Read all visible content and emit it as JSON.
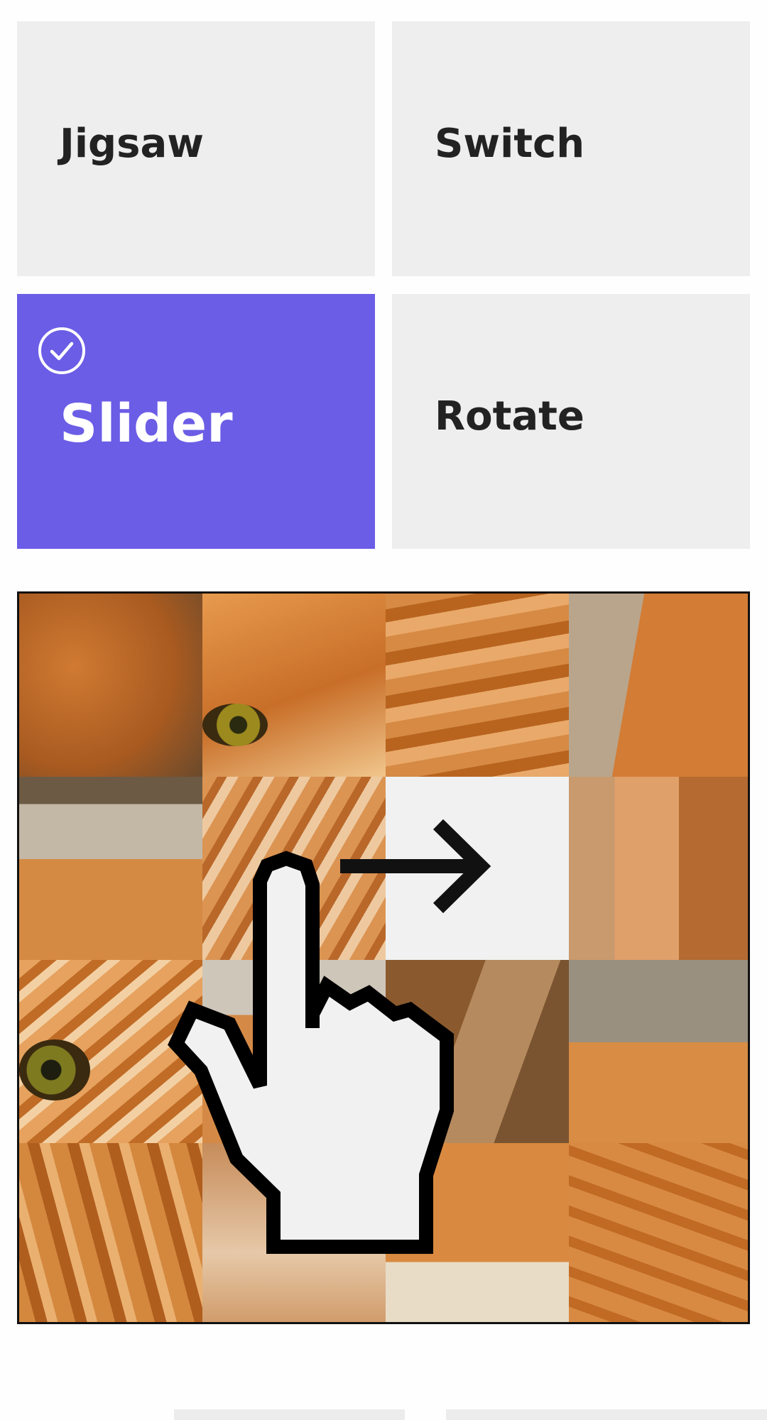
{
  "modes": {
    "jigsaw": {
      "label": "Jigsaw",
      "selected": false
    },
    "switch": {
      "label": "Switch",
      "selected": false
    },
    "slider": {
      "label": "Slider",
      "selected": true
    },
    "rotate": {
      "label": "Rotate",
      "selected": false
    }
  },
  "colors": {
    "accent": "#6b5de6",
    "tile_bg": "#eeeeee",
    "empty_slot": "#f1f1f1",
    "cat_orange": "#d9843a"
  },
  "icons": {
    "selected_mark": "check-circle-icon",
    "hint": "hand-pointer-icon",
    "direction": "arrow-right-icon"
  },
  "puzzle": {
    "grid_size": 4,
    "empty_slot": {
      "row": 1,
      "col": 2
    }
  }
}
